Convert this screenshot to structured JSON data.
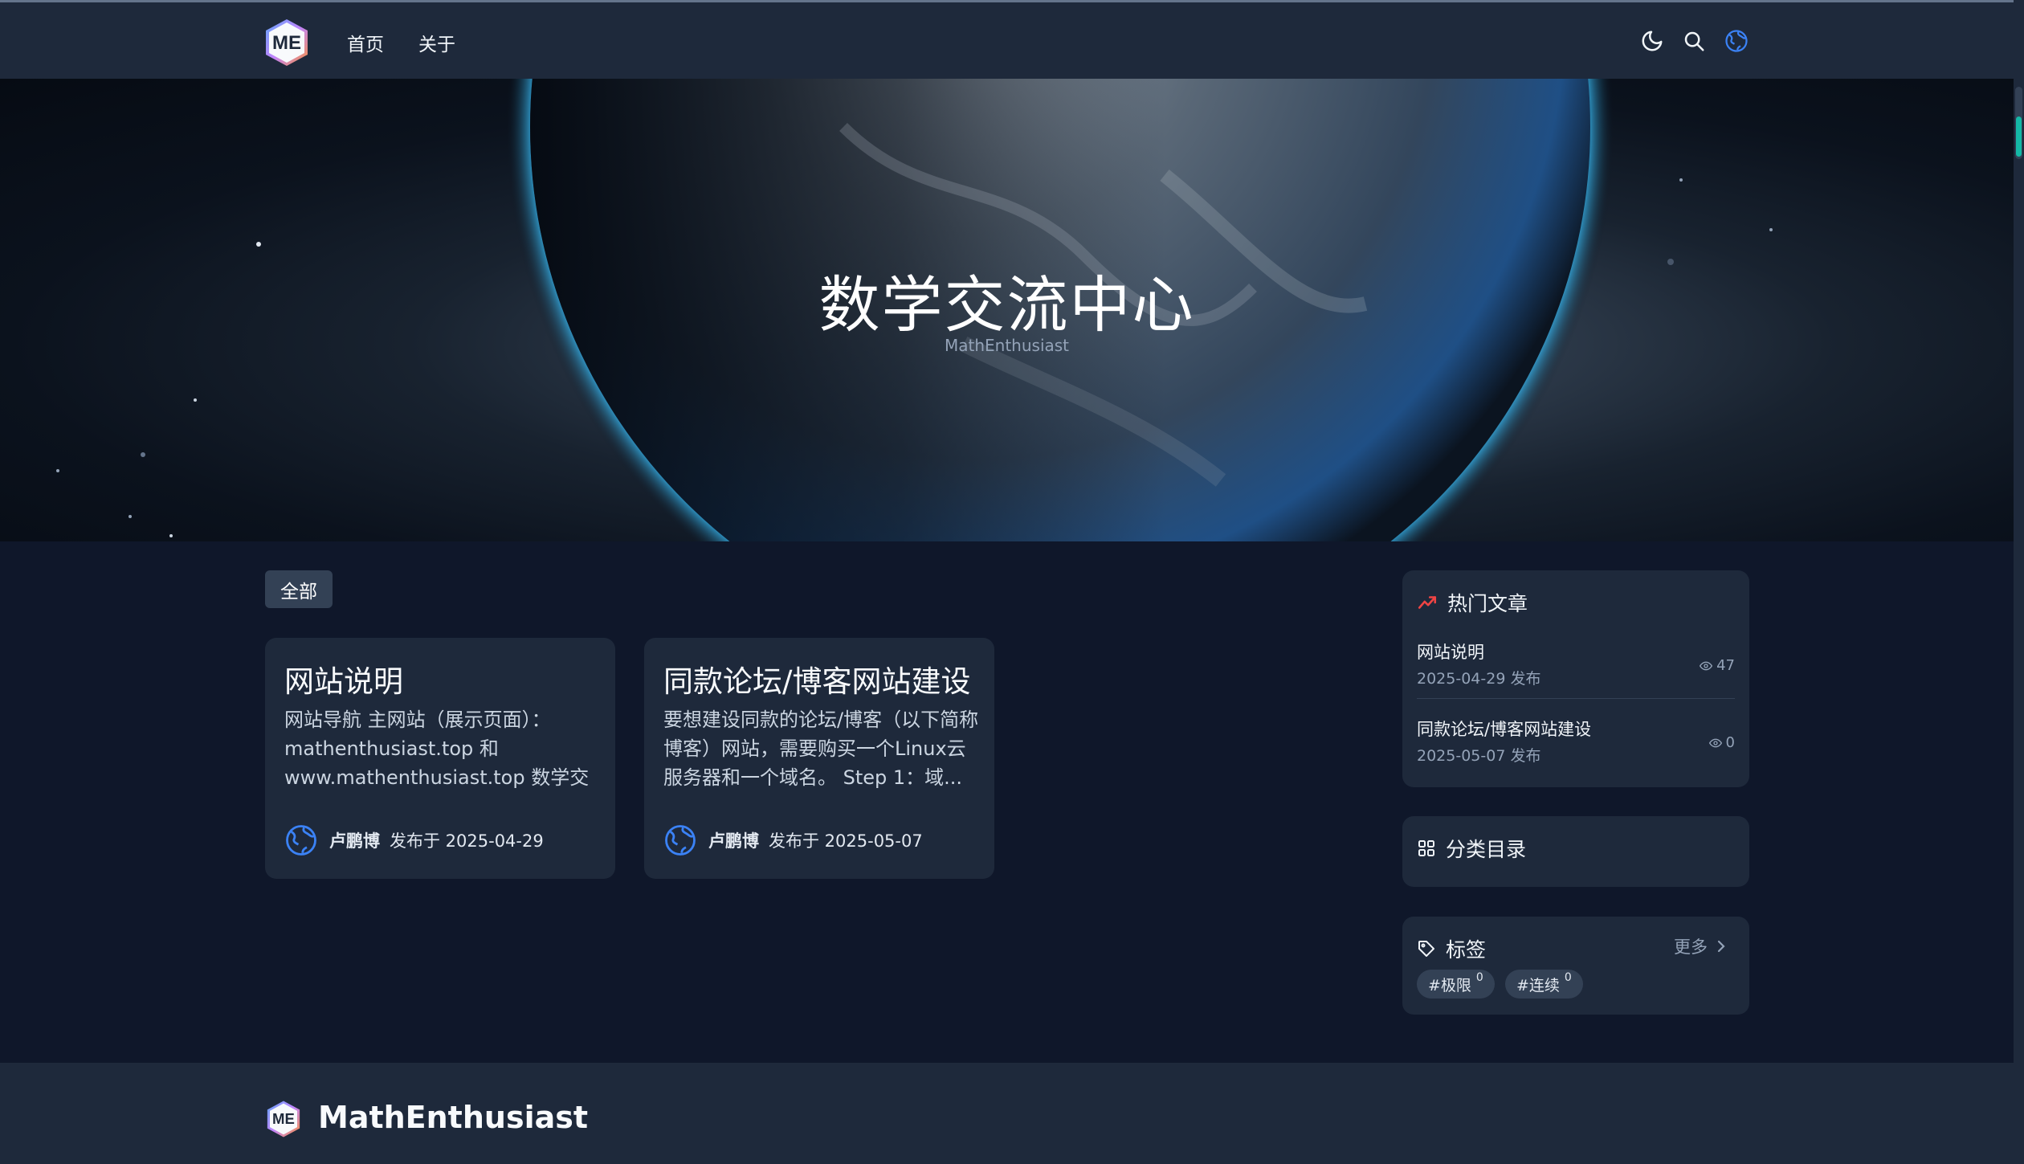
{
  "nav": {
    "logo_text": "ME",
    "links": [
      "首页",
      "关于"
    ]
  },
  "hero": {
    "title": "数学交流中心",
    "subtitle": "MathEnthusiast"
  },
  "filter": {
    "active": "全部"
  },
  "posts": [
    {
      "title": "网站说明",
      "excerpt": "网站导航 主网站（展示页面）：mathenthusiast.top 和 www.mathenthusiast.top 数学交流...",
      "author": "卢鹏博",
      "published": "发布于 2025-04-29"
    },
    {
      "title": "同款论坛/博客网站建设",
      "excerpt": "要想建设同款的论坛/博客（以下简称博客）网站，需要购买一个Linux云服务器和一个域名。 Step 1：域...",
      "author": "卢鹏博",
      "published": "发布于 2025-05-07"
    }
  ],
  "sidebar": {
    "hot": {
      "heading": "热门文章",
      "items": [
        {
          "title": "网站说明",
          "date": "2025-04-29 发布",
          "views": "47"
        },
        {
          "title": "同款论坛/博客网站建设",
          "date": "2025-05-07 发布",
          "views": "0"
        }
      ]
    },
    "categories": {
      "heading": "分类目录"
    },
    "tags": {
      "heading": "标签",
      "more": "更多",
      "items": [
        {
          "label": "#极限",
          "count": "0"
        },
        {
          "label": "#连续",
          "count": "0"
        }
      ]
    }
  },
  "footer": {
    "brand": "MathEnthusiast",
    "logo_text": "ME"
  },
  "colors": {
    "background": "#0f172a",
    "surface": "#1e293b",
    "accent": "#3b82f6",
    "hot_icon": "#ef4444",
    "scroll_accent": "#14b8a6"
  }
}
